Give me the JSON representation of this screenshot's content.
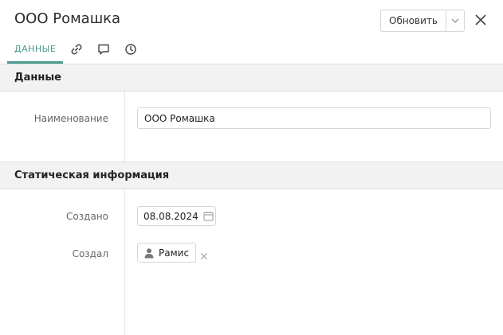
{
  "header": {
    "title": "ООО Ромашка",
    "refresh_label": "Обновить"
  },
  "tabs": [
    {
      "label": "ДАННЫЕ",
      "active": true
    },
    {
      "icon": "link-icon"
    },
    {
      "icon": "comment-icon"
    },
    {
      "icon": "history-icon"
    }
  ],
  "sections": {
    "data": {
      "title": "Данные",
      "name_label": "Наименование",
      "name_value": "ООО Ромашка"
    },
    "static": {
      "title": "Статическая информация",
      "created_label": "Создано",
      "created_value": "08.08.2024",
      "creator_label": "Создал",
      "creator_value": "Рамис"
    }
  },
  "colors": {
    "accent": "#4a9a8d",
    "section_bg": "#f2f2f2"
  }
}
